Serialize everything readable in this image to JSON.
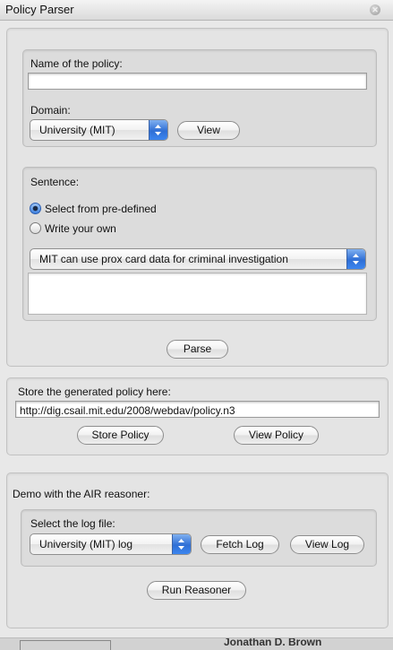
{
  "window": {
    "title": "Policy Parser"
  },
  "policy_name": {
    "label": "Name of the policy:",
    "value": ""
  },
  "domain": {
    "label": "Domain:",
    "selected": "University (MIT)",
    "view_button": "View"
  },
  "sentence": {
    "label": "Sentence:",
    "option_predefined": "Select from pre-defined",
    "option_own": "Write your own",
    "selected_option": "Select from pre-defined",
    "selected_sentence": "MIT can use prox card data for criminal investigation",
    "custom_text": ""
  },
  "parse_button": "Parse",
  "store": {
    "label": "Store the generated policy here:",
    "url": "http://dig.csail.mit.edu/2008/webdav/policy.n3",
    "store_button": "Store Policy",
    "view_button": "View Policy"
  },
  "demo": {
    "label": "Demo with the AIR reasoner:",
    "log_label": "Select the log file:",
    "log_selected": "University (MIT) log",
    "fetch_button": "Fetch Log",
    "view_button": "View Log",
    "run_button": "Run Reasoner"
  },
  "background_window": {
    "visible_text": "Jonathan D. Brown"
  },
  "icons": {
    "close": "close-icon",
    "popup_arrows": "updown-arrows-icon"
  },
  "colors": {
    "selection_blue": "#3c7ee8",
    "panel_bg": "#e4e4e4"
  }
}
